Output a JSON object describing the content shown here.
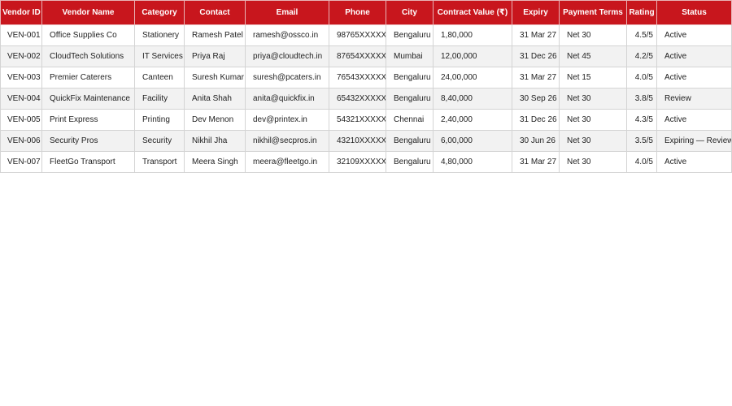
{
  "table": {
    "columns": [
      "Vendor ID",
      "Vendor Name",
      "Category",
      "Contact",
      "Email",
      "Phone",
      "City",
      "Contract Value (₹)",
      "Expiry",
      "Payment Terms",
      "Rating",
      "Status"
    ],
    "rows": [
      {
        "id": "VEN-001",
        "name": "Office Supplies Co",
        "category": "Stationery",
        "contact": "Ramesh Patel",
        "email": "ramesh@ossco.in",
        "phone": "98765XXXXX",
        "city": "Bengaluru",
        "value": "1,80,000",
        "expiry": "31 Mar 27",
        "terms": "Net 30",
        "rating": "4.5/5",
        "status": "Active"
      },
      {
        "id": "VEN-002",
        "name": "CloudTech Solutions",
        "category": "IT Services",
        "contact": "Priya Raj",
        "email": "priya@cloudtech.in",
        "phone": "87654XXXXX",
        "city": "Mumbai",
        "value": "12,00,000",
        "expiry": "31 Dec 26",
        "terms": "Net 45",
        "rating": "4.2/5",
        "status": "Active"
      },
      {
        "id": "VEN-003",
        "name": "Premier Caterers",
        "category": "Canteen",
        "contact": "Suresh Kumar",
        "email": "suresh@pcaters.in",
        "phone": "76543XXXXX",
        "city": "Bengaluru",
        "value": "24,00,000",
        "expiry": "31 Mar 27",
        "terms": "Net 15",
        "rating": "4.0/5",
        "status": "Active"
      },
      {
        "id": "VEN-004",
        "name": "QuickFix Maintenance",
        "category": "Facility",
        "contact": "Anita Shah",
        "email": "anita@quickfix.in",
        "phone": "65432XXXXX",
        "city": "Bengaluru",
        "value": "8,40,000",
        "expiry": "30 Sep 26",
        "terms": "Net 30",
        "rating": "3.8/5",
        "status": "Review"
      },
      {
        "id": "VEN-005",
        "name": "Print Express",
        "category": "Printing",
        "contact": "Dev Menon",
        "email": "dev@printex.in",
        "phone": "54321XXXXX",
        "city": "Chennai",
        "value": "2,40,000",
        "expiry": "31 Dec 26",
        "terms": "Net 30",
        "rating": "4.3/5",
        "status": "Active"
      },
      {
        "id": "VEN-006",
        "name": "Security Pros",
        "category": "Security",
        "contact": "Nikhil Jha",
        "email": "nikhil@secpros.in",
        "phone": "43210XXXXX",
        "city": "Bengaluru",
        "value": "6,00,000",
        "expiry": "30 Jun 26",
        "terms": "Net 30",
        "rating": "3.5/5",
        "status": "Expiring — Review"
      },
      {
        "id": "VEN-007",
        "name": "FleetGo Transport",
        "category": "Transport",
        "contact": "Meera Singh",
        "email": "meera@fleetgo.in",
        "phone": "32109XXXXX",
        "city": "Bengaluru",
        "value": "4,80,000",
        "expiry": "31 Mar 27",
        "terms": "Net 30",
        "rating": "4.0/5",
        "status": "Active"
      }
    ]
  },
  "colors": {
    "header_background": "#c8161d",
    "header_text": "#ffffff",
    "stripe_background": "#f2f2f2",
    "grid_line": "#d4d4d4"
  }
}
